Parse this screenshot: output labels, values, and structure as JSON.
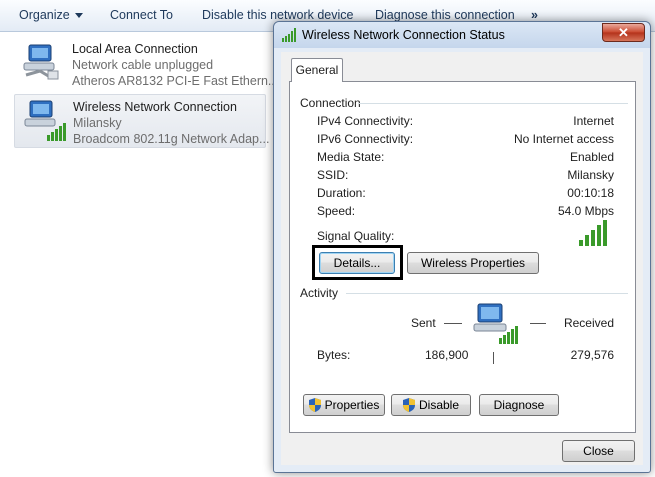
{
  "toolbar": {
    "organize": "Organize",
    "connect_to": "Connect To",
    "disable_device": "Disable this network device",
    "diagnose": "Diagnose this connection",
    "more": "»"
  },
  "connections": [
    {
      "name": "Local Area Connection",
      "status": "Network cable unplugged",
      "adapter": "Atheros AR8132 PCI-E Fast Ethern..."
    },
    {
      "name": "Wireless Network Connection",
      "status": "Milansky",
      "adapter": "Broadcom 802.11g Network Adap..."
    }
  ],
  "dialog": {
    "title": "Wireless Network Connection Status",
    "close_glyph": "✕",
    "tab_general": "General",
    "connection_group": "Connection",
    "rows": [
      {
        "label": "IPv4 Connectivity:",
        "value": "Internet"
      },
      {
        "label": "IPv6 Connectivity:",
        "value": "No Internet access"
      },
      {
        "label": "Media State:",
        "value": "Enabled"
      },
      {
        "label": "SSID:",
        "value": "Milansky"
      },
      {
        "label": "Duration:",
        "value": "00:10:18"
      },
      {
        "label": "Speed:",
        "value": "54.0 Mbps"
      }
    ],
    "signal_label": "Signal Quality:",
    "signal_bars": 5,
    "details_button": "Details...",
    "wireless_properties_button": "Wireless Properties",
    "activity_group": "Activity",
    "sent_label": "Sent",
    "received_label": "Received",
    "bytes_label": "Bytes:",
    "bytes_sent": "186,900",
    "bytes_received": "279,576",
    "properties_button": "Properties",
    "disable_button": "Disable",
    "diagnose_button": "Diagnose",
    "close_button": "Close"
  },
  "colors": {
    "signal_green": "#3a9a2a",
    "highlight": "#000000",
    "toolbar_text": "#1e395b"
  }
}
